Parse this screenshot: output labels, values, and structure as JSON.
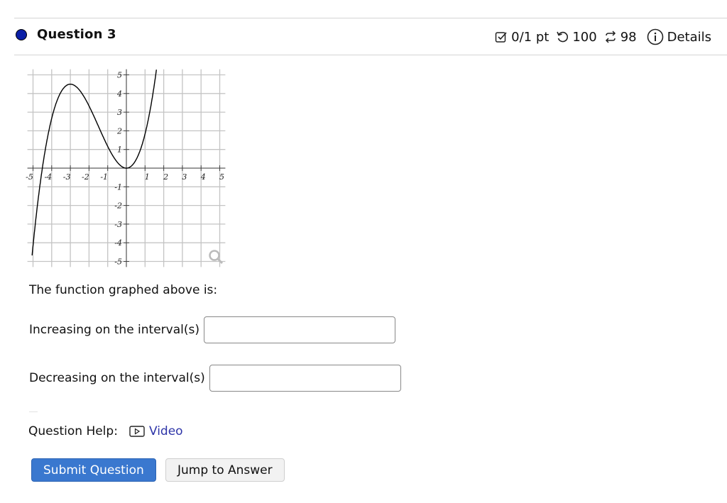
{
  "question": {
    "title": "Question 3",
    "status_color": "#0b1fa6"
  },
  "meta": {
    "score": "0/1 pt",
    "retries": "100",
    "attempts": "98",
    "details_label": "Details",
    "icons": [
      "checkbox-icon",
      "undo-icon",
      "repeat-icon",
      "info-icon"
    ]
  },
  "graph": {
    "function_description": "cubic with local max at (-3, 4.5) and local min at (0, 0)",
    "x_ticks": [
      "-5",
      "-4",
      "-3",
      "-2",
      "-1",
      "1",
      "2",
      "3",
      "4",
      "5"
    ],
    "y_ticks": [
      "5",
      "4",
      "3",
      "2",
      "1",
      "-1",
      "-2",
      "-3",
      "-4",
      "-5"
    ],
    "xlim": [
      -5,
      5
    ],
    "ylim": [
      -5,
      5
    ],
    "zoom_icon": "magnifier-icon"
  },
  "prompt": "The function graphed above is:",
  "fields": [
    {
      "label": "Increasing on the interval(s)",
      "value": "",
      "placeholder": ""
    },
    {
      "label": "Decreasing on the interval(s)",
      "value": "",
      "placeholder": ""
    }
  ],
  "help": {
    "label": "Question Help:",
    "video_label": "Video"
  },
  "buttons": {
    "submit": "Submit Question",
    "jump": "Jump to Answer"
  }
}
